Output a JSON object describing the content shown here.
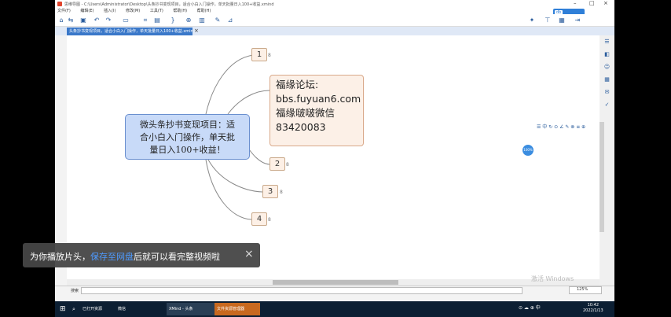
{
  "window": {
    "title": "思维导图 - C:\\Users\\Administrator\\Desktop\\头条抄书变现项目，适合小白入门操作，单天批量日入100+收益.xmind"
  },
  "menu": [
    "文件(F)",
    "编辑(E)",
    "插入(I)",
    "修改(M)",
    "工具(T)",
    "帮助(H)",
    "帮助(H)"
  ],
  "cloud": {
    "badge": "db",
    "label": "会员注册"
  },
  "tab": {
    "label": "头条抄书变现项目，适合小白入门操作，单天批量日入100+收益.xmind"
  },
  "mindmap": {
    "central_lines": [
      "微头条抄书变现项目：适",
      "合小白入门操作，单天批",
      "量日入100+收益！"
    ],
    "note_lines": [
      "福缘论坛:",
      "bbs.fuyuan6.com",
      "福缘啵啵微信",
      "83420083"
    ],
    "branches": [
      "1",
      "2",
      "3",
      "4"
    ],
    "collapse_marker": "8"
  },
  "float_toolbar": "☰ 中 ↻ ⊙ ∠ ✎ ⊗ ≡ ⊕",
  "blue_dot": "100%",
  "status": {
    "left_label": "搜索",
    "zoom": "125%"
  },
  "watermark": "激活 Windows",
  "toast": {
    "prefix": "为你播放片头，",
    "link": "保存至网盘",
    "suffix": "后就可以看完整视频啦"
  },
  "taskbar": {
    "items": [
      "已打开资源",
      "微信",
      "XMind - 头条",
      "文件资源管理器"
    ],
    "tray": "⊙ ☁ ⊕ 中 ",
    "time": "10:42",
    "date": "2022/1/13"
  }
}
